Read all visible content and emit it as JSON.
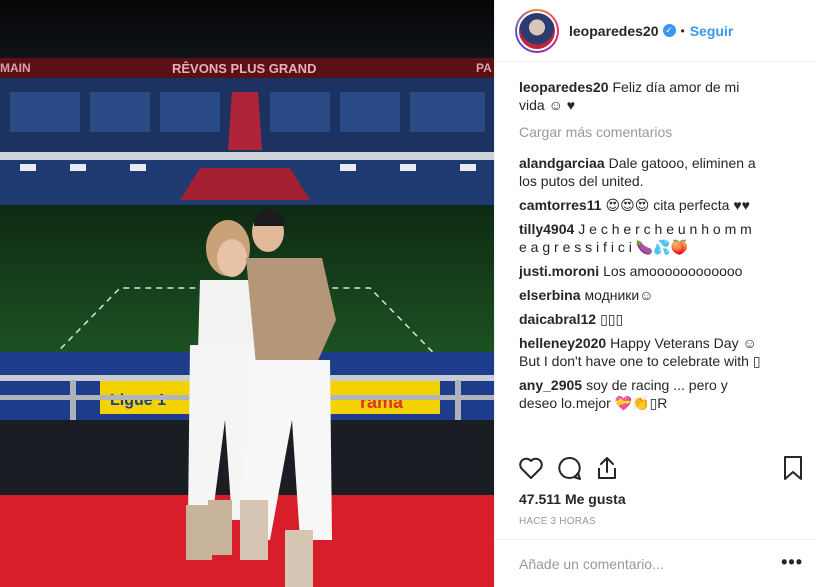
{
  "photo": {
    "banner_text": "RÊVONS PLUS GRAND",
    "banner_side_left": "MAIN",
    "banner_side_right": "PA",
    "ad_left": "Ligue 1",
    "ad_right": "rama"
  },
  "header": {
    "username": "leoparedes20",
    "separator": "•",
    "follow_label": "Seguir"
  },
  "caption": {
    "username": "leoparedes20",
    "text": "Feliz día amor de mi vida ☺ ♥"
  },
  "load_more_label": "Cargar más comentarios",
  "comments": [
    {
      "user": "alandgarciaa",
      "text": "Dale gatooo, eliminen a los putos del united."
    },
    {
      "user": "camtorres11",
      "text": "😍😍😍 cita perfecta ♥♥"
    },
    {
      "user": "tilly4904",
      "text": "J e c h e r c h e u n h o m m e a g r e s s i f i c i 🍆💦🍑"
    },
    {
      "user": "justi.moroni",
      "text": "Los amoooooooooooo"
    },
    {
      "user": "elserbina",
      "text": "модники☺"
    },
    {
      "user": "daicabral12",
      "text": "▯▯▯"
    },
    {
      "user": "helleney2020",
      "text": "Happy Veterans Day ☺ But I don't have one to celebrate with ▯"
    },
    {
      "user": "any_2905",
      "text": "soy de racing ... pero y deseo lo.mejor 💝👏▯R"
    }
  ],
  "likes": "47.511 Me gusta",
  "timestamp": "HACE 3 HORAS",
  "add_comment": {
    "placeholder": "Añade un comentario..."
  },
  "more_label": "•••",
  "colors": {
    "link": "#3897f0",
    "muted": "#999999",
    "text": "#262626"
  }
}
